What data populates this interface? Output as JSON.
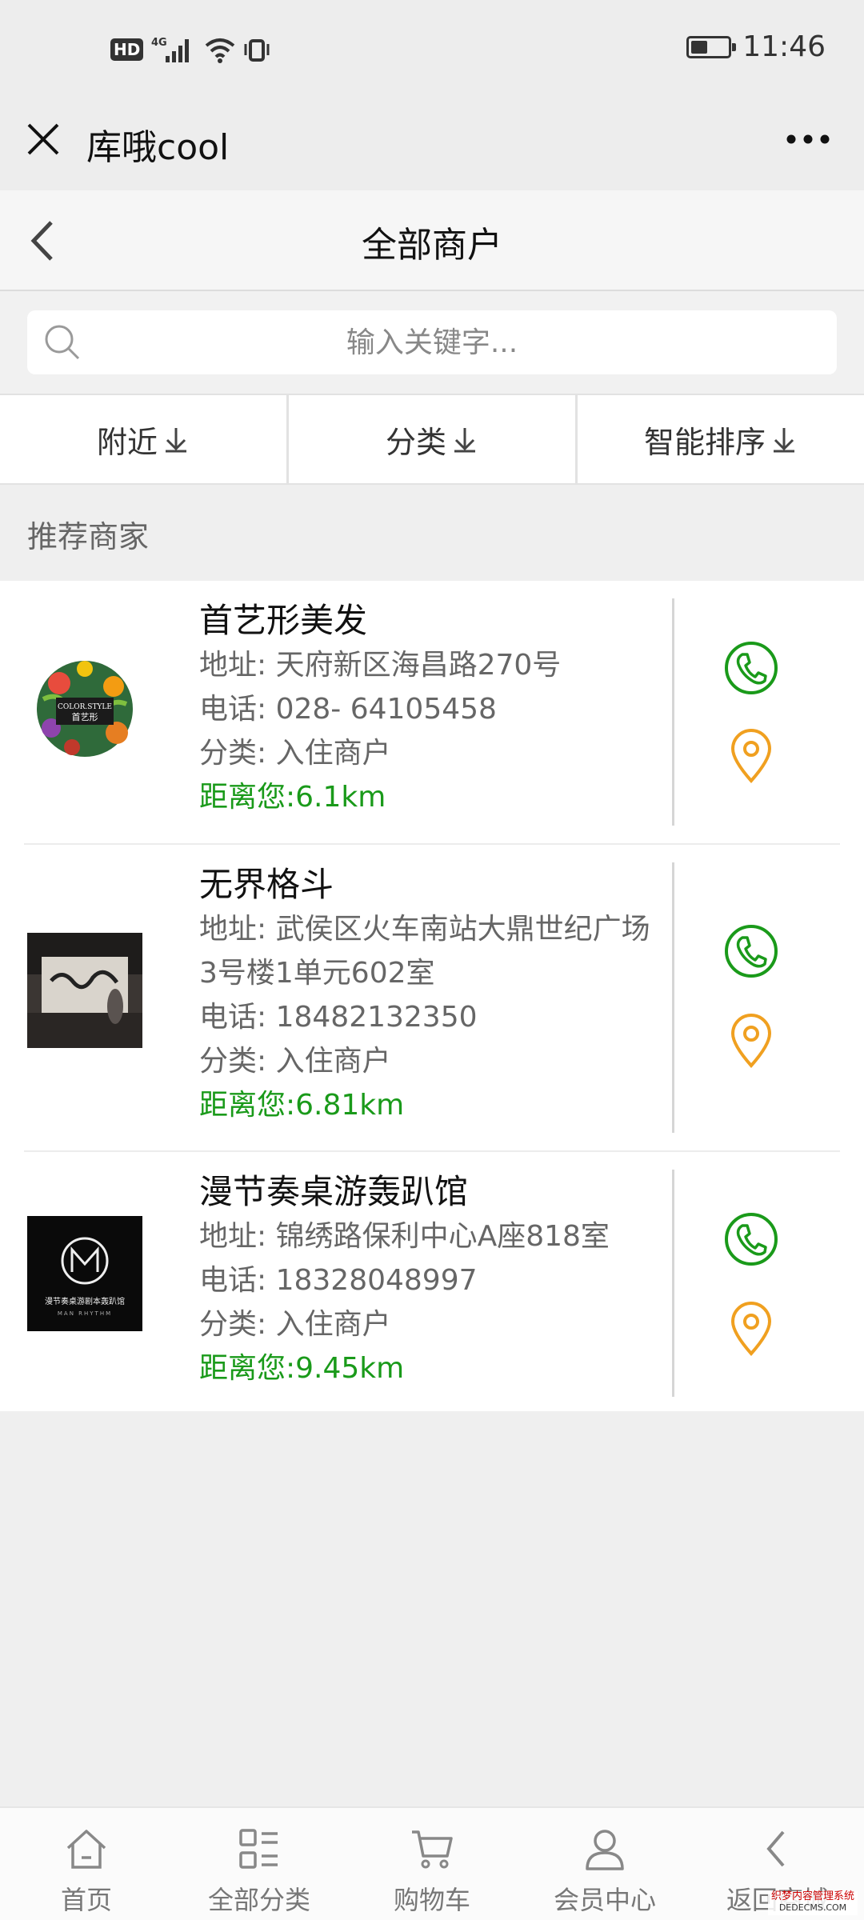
{
  "status_bar": {
    "hd": "HD",
    "network": "4G",
    "time": "11:46",
    "battery_level": 0.45
  },
  "wechat_bar": {
    "title": "库哦cool"
  },
  "header": {
    "title": "全部商户"
  },
  "search": {
    "placeholder": "输入关键字..."
  },
  "filters": [
    {
      "label": "附近"
    },
    {
      "label": "分类"
    },
    {
      "label": "智能排序"
    }
  ],
  "section": {
    "title": "推荐商家"
  },
  "merchants": [
    {
      "name": "首艺形美发",
      "address": "地址: 天府新区海昌路270号",
      "address_2": "",
      "phone": "电话: 028- 64105458",
      "category": "分类: 入住商户",
      "distance": "距离您:6.1km",
      "logo_text": "COLOR.STYLE",
      "logo_text_2": "首艺形"
    },
    {
      "name": "无界格斗",
      "address": "地址: 武侯区火车南站大鼎世纪广场",
      "address_2": "3号楼1单元602室",
      "phone": "电话: 18482132350",
      "category": "分类: 入住商户",
      "distance": "距离您:6.81km",
      "logo_text": "",
      "logo_text_2": ""
    },
    {
      "name": "漫节奏桌游轰趴馆",
      "address": "地址: 锦绣路保利中心A座818室",
      "address_2": "",
      "phone": "电话: 18328048997",
      "category": "分类: 入住商户",
      "distance": "距离您:9.45km",
      "logo_text": "漫节奏桌游剧本轰趴馆",
      "logo_text_2": "MAN RHYTHM"
    }
  ],
  "bottom_nav": [
    {
      "label": "首页",
      "icon": "home-icon"
    },
    {
      "label": "全部分类",
      "icon": "category-grid-icon"
    },
    {
      "label": "购物车",
      "icon": "cart-icon"
    },
    {
      "label": "会员中心",
      "icon": "user-icon"
    },
    {
      "label": "返回商城",
      "icon": "chevron-left-icon"
    }
  ],
  "watermark": {
    "line1": "织梦内容管理系统",
    "line2": "DEDECMS.COM"
  },
  "colors": {
    "accent_green": "#1a9a1a",
    "location_orange": "#f0a020",
    "page_bg": "#efefef"
  }
}
